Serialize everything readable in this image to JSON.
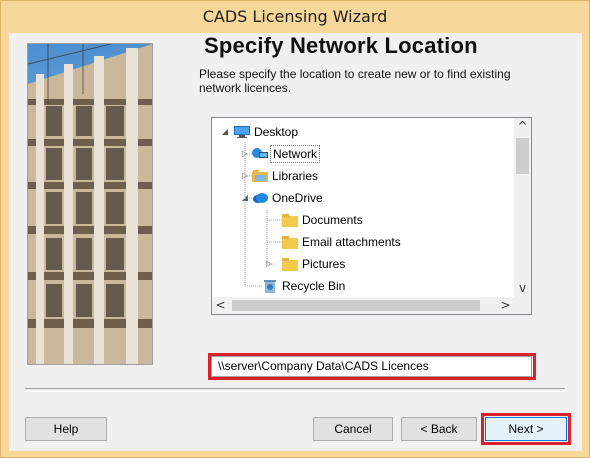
{
  "window": {
    "title": "CADS Licensing Wizard"
  },
  "page": {
    "heading": "Specify Network Location",
    "description": "Please specify the location to create new or to find existing network licences."
  },
  "tree": {
    "items": [
      {
        "label": "Desktop",
        "icon": "desktop-icon",
        "expander": "expanded"
      },
      {
        "label": "Network",
        "icon": "network-icon",
        "expander": "collapsed",
        "selected": true
      },
      {
        "label": "Libraries",
        "icon": "libraries-icon",
        "expander": "collapsed"
      },
      {
        "label": "OneDrive",
        "icon": "onedrive-icon",
        "expander": "expanded"
      },
      {
        "label": "Documents",
        "icon": "folder-icon"
      },
      {
        "label": "Email attachments",
        "icon": "folder-icon"
      },
      {
        "label": "Pictures",
        "icon": "folder-icon",
        "expander": "collapsed"
      },
      {
        "label": "Recycle Bin",
        "icon": "recycle-bin-icon"
      }
    ],
    "scroll_up": "^",
    "scroll_down": "v",
    "scroll_left": "<",
    "scroll_right": ">"
  },
  "path": {
    "value": "\\\\server\\Company Data\\CADS Licences"
  },
  "buttons": {
    "help": "Help",
    "cancel": "Cancel",
    "back": "< Back",
    "next": "Next >"
  },
  "colors": {
    "frame": "#f8d79a",
    "highlight": "#d9222b",
    "client": "#f0f0f0"
  }
}
